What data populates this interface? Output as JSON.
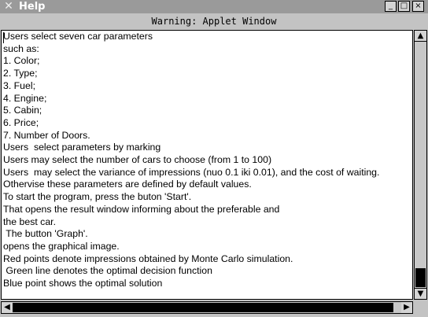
{
  "window": {
    "title": "Help",
    "app_icon": "x-app-icon",
    "controls": {
      "minimize": "_",
      "maximize": "□",
      "close": "×"
    }
  },
  "warning_banner": "Warning: Applet Window",
  "help_text": [
    "Users select seven car parameters",
    "such as:",
    "1. Color;",
    "2. Type;",
    "3. Fuel;",
    "4. Engine;",
    "5. Cabin;",
    "6. Price;",
    "7. Number of Doors.",
    "Users  select parameters by marking",
    "Users may select the number of cars to choose (from 1 to 100)",
    "Users  may select the variance of impressions (nuo 0.1 iki 0.01), and the cost of waiting.",
    "Othervise these parameters are defined by default values.",
    "To start the program, press the buton 'Start'.",
    "That opens the result window informing about the preferable and",
    "the best car.",
    " The button 'Graph'.",
    "opens the graphical image.",
    "Red points denote impressions obtained by Monte Carlo simulation.",
    " Green line denotes the optimal decision function",
    "Blue point shows the optimal solution"
  ],
  "scrollbars": {
    "up_arrow": "▲",
    "down_arrow": "▼",
    "left_arrow": "◀",
    "right_arrow": "▶"
  }
}
